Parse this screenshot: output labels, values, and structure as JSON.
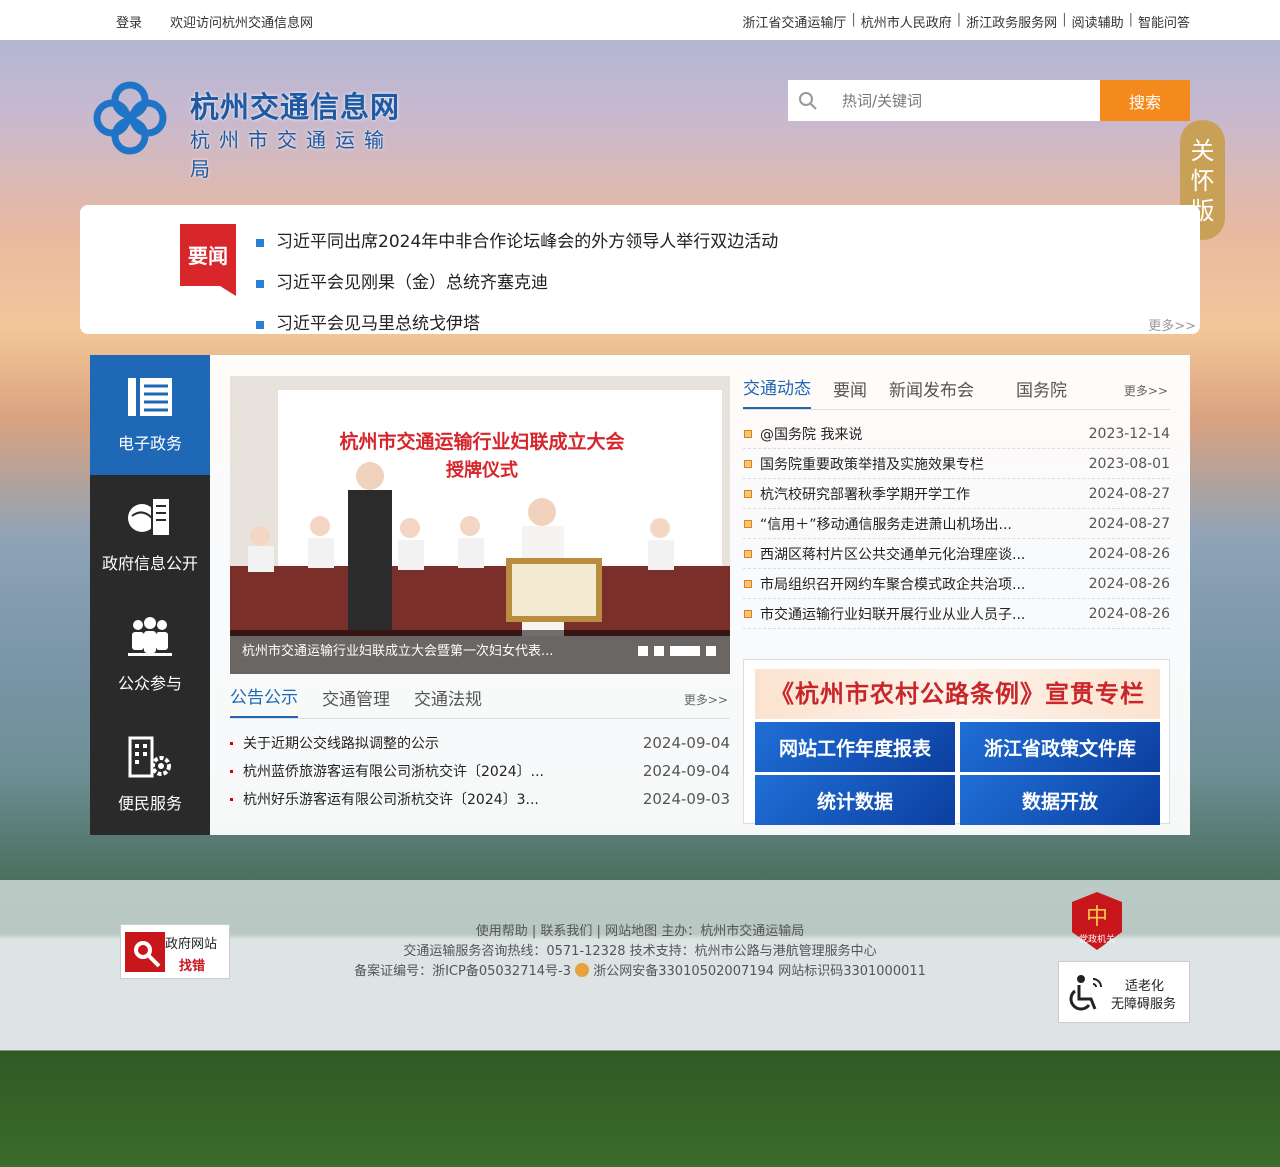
{
  "topbar": {
    "login": "登录",
    "welcome": "欢迎访问杭州交通信息网",
    "links": [
      "浙江省交通运输厅",
      "杭州市人民政府",
      "浙江政务服务网",
      "阅读辅助",
      "智能问答"
    ],
    "separator": "|"
  },
  "logo": {
    "title": "杭州交通信息网",
    "subtitle": "杭州市交通运输局"
  },
  "search": {
    "placeholder": "热词/关键词",
    "button": "搜索"
  },
  "care_mode": {
    "chars": [
      "关",
      "怀",
      "版"
    ]
  },
  "headline": {
    "badge": "要闻",
    "items": [
      "习近平同出席2024年中非合作论坛峰会的外方领导人举行双边活动",
      "习近平会见刚果（金）总统齐塞克迪",
      "习近平会见马里总统戈伊塔"
    ],
    "more": "更多>>"
  },
  "sidebar": {
    "items": [
      {
        "label": "电子政务",
        "icon": "list-icon"
      },
      {
        "label": "政府信息公开",
        "icon": "globe-document-icon"
      },
      {
        "label": "公众参与",
        "icon": "people-icon"
      },
      {
        "label": "便民服务",
        "icon": "building-gear-icon"
      }
    ]
  },
  "slider": {
    "caption": "杭州市交通运输行业妇联成立大会暨第一次妇女代表...",
    "banner_line1": "杭州市交通运输行业妇联成立大会",
    "banner_line2": "授牌仪式"
  },
  "news_tabs": {
    "tabs": [
      "交通动态",
      "要闻",
      "新闻发布会",
      "国务院"
    ],
    "more": "更多>>",
    "items": [
      {
        "title": "@国务院 我来说",
        "date": "2023-12-14"
      },
      {
        "title": "国务院重要政策举措及实施效果专栏",
        "date": "2023-08-01"
      },
      {
        "title": "杭汽校研究部署秋季学期开学工作",
        "date": "2024-08-27"
      },
      {
        "title": "“信用＋”移动通信服务走进萧山机场出...",
        "date": "2024-08-27"
      },
      {
        "title": "西湖区蒋村片区公共交通单元化治理座谈...",
        "date": "2024-08-26"
      },
      {
        "title": "市局组织召开网约车聚合模式政企共治项...",
        "date": "2024-08-26"
      },
      {
        "title": "市交通运输行业妇联开展行业从业人员子...",
        "date": "2024-08-26"
      }
    ]
  },
  "notice_tabs": {
    "tabs": [
      "公告公示",
      "交通管理",
      "交通法规"
    ],
    "more": "更多>>",
    "items": [
      {
        "title": "关于近期公交线路拟调整的公示",
        "date": "2024-09-04"
      },
      {
        "title": "杭州蓝侨旅游客运有限公司浙杭交许〔2024〕...",
        "date": "2024-09-04"
      },
      {
        "title": "杭州好乐游客运有限公司浙杭交许〔2024〕3...",
        "date": "2024-09-03"
      }
    ]
  },
  "promo": {
    "banner": "《杭州市农村公路条例》宣贯专栏",
    "buttons": [
      "网站工作年度报表",
      "浙江省政策文件库",
      "统计数据",
      "数据开放"
    ]
  },
  "footer": {
    "line1": "使用帮助 | 联系我们 | 网站地图 主办：杭州市交通运输局",
    "line2": "交通运输服务咨询热线：0571-12328 技术支持：杭州市公路与港航管理服务中心",
    "line3a": "备案证编号：浙ICP备05032714号-3",
    "line3b": "浙公网安备33010502007194 网站标识码3301000011",
    "findbug_top": "政府网站",
    "findbug_bottom": "找错",
    "party_label": "党政机关",
    "aging_line1": "适老化",
    "aging_line2": "无障碍服务"
  }
}
